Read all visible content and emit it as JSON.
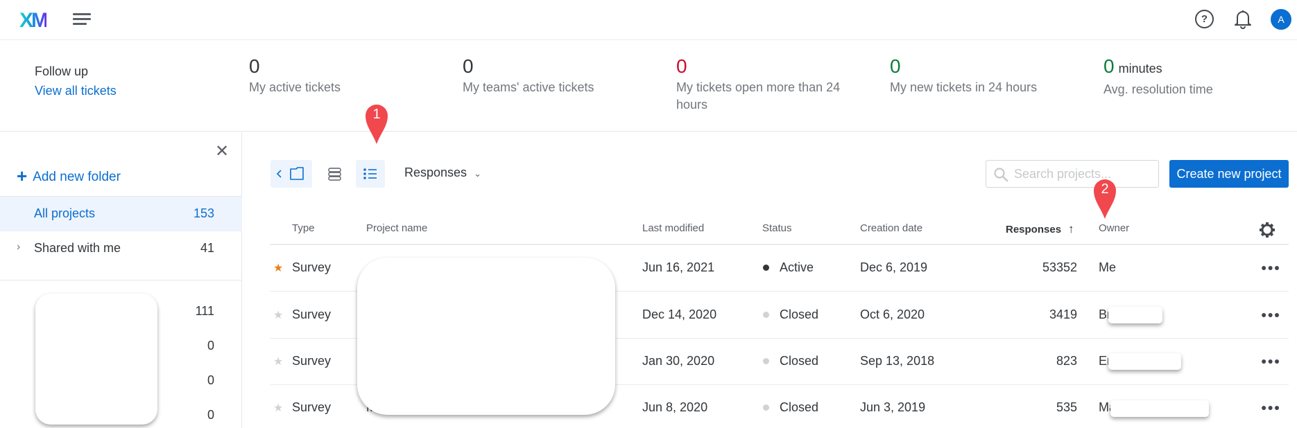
{
  "topnav": {
    "logo": "XM",
    "avatar_initial": "A",
    "icons": [
      "menu-icon",
      "help-icon",
      "bell-icon"
    ]
  },
  "stats": {
    "follow_up_title": "Follow up",
    "view_all_link": "View all tickets",
    "items": [
      {
        "value": "0",
        "label": "My active tickets",
        "color": "#32363a"
      },
      {
        "value": "0",
        "label": "My teams' active tickets",
        "color": "#32363a"
      },
      {
        "value": "0",
        "label": "My tickets open more than 24 hours",
        "color": "#c8102e"
      },
      {
        "value": "0",
        "label": "My new tickets in 24 hours",
        "color": "#0c7d3e"
      },
      {
        "value": "0",
        "unit": "minutes",
        "label": "Avg. resolution time",
        "color": "#0c7d3e"
      }
    ]
  },
  "sidebar": {
    "add_folder": "Add new folder",
    "items": [
      {
        "name": "All projects",
        "count": "153",
        "active": true
      },
      {
        "name": "Shared with me",
        "count": "41",
        "expandable": true
      }
    ],
    "folders": [
      {
        "name": "",
        "count": "111"
      },
      {
        "name": "",
        "count": "0"
      },
      {
        "name": "",
        "count": "0"
      },
      {
        "name": "",
        "count": "0"
      }
    ]
  },
  "toolbar": {
    "sort_dropdown": "Responses",
    "search_placeholder": "Search projects...",
    "create_button": "Create new project"
  },
  "table": {
    "columns": [
      "Type",
      "Project name",
      "Last modified",
      "Status",
      "Creation date",
      "Responses",
      "Owner"
    ],
    "sorted_column": "Responses",
    "sort_direction": "ascending",
    "rows": [
      {
        "favorite": true,
        "type": "Survey",
        "name": "",
        "last_modified": "Jun 16, 2021",
        "status": "Active",
        "created": "Dec 6, 2019",
        "responses": "53352",
        "owner": "Me"
      },
      {
        "favorite": false,
        "type": "Survey",
        "name": "",
        "last_modified": "Dec 14, 2020",
        "status": "Closed",
        "created": "Oct 6, 2020",
        "responses": "3419",
        "owner": "Br"
      },
      {
        "favorite": false,
        "type": "Survey",
        "name": "",
        "last_modified": "Jan 30, 2020",
        "status": "Closed",
        "created": "Sep 13, 2018",
        "responses": "823",
        "owner": "Er"
      },
      {
        "favorite": false,
        "type": "Survey",
        "name": "M",
        "last_modified": "Jun 8, 2020",
        "status": "Closed",
        "created": "Jun 3, 2019",
        "responses": "535",
        "owner": "Ma"
      }
    ]
  },
  "annotations": [
    {
      "label": "1"
    },
    {
      "label": "2"
    }
  ],
  "colors": {
    "accent": "#0b6ed0",
    "marker": "#f0484d",
    "star_on": "#e8801e",
    "star_off": "#d0d2d4",
    "status_active": "#32363a",
    "status_closed": "#d0d2d4"
  }
}
